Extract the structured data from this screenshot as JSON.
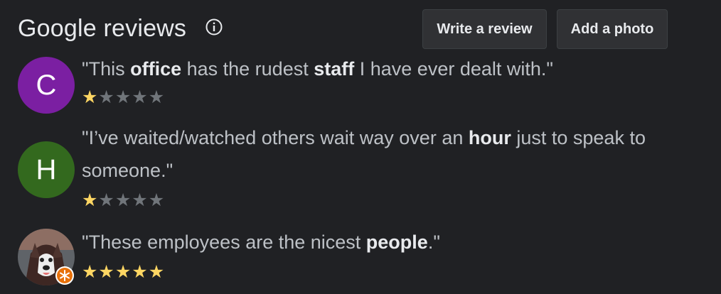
{
  "header": {
    "title": "Google reviews",
    "info_icon": "info-icon",
    "write_review_label": "Write a review",
    "add_photo_label": "Add a photo"
  },
  "colors": {
    "background": "#202124",
    "button_bg": "#303134",
    "star_filled": "#fdd663",
    "star_empty": "#70757a",
    "avatar_c": "#7b1fa2",
    "avatar_h": "#33691e"
  },
  "reviews": [
    {
      "avatar_letter": "C",
      "quote": [
        {
          "text": "\"This ",
          "bold": false
        },
        {
          "text": "office",
          "bold": true
        },
        {
          "text": " has the rudest ",
          "bold": false
        },
        {
          "text": "staff",
          "bold": true
        },
        {
          "text": " I have ever dealt with.\"",
          "bold": false
        }
      ],
      "rating": 1,
      "max_rating": 5
    },
    {
      "avatar_letter": "H",
      "quote": [
        {
          "text": "\"I’ve waited/watched others wait way over an ",
          "bold": false
        },
        {
          "text": "hour",
          "bold": true
        },
        {
          "text": " just to speak to someone.\"",
          "bold": false
        }
      ],
      "rating": 1,
      "max_rating": 5
    },
    {
      "avatar_letter": "",
      "avatar_image": "dog-photo-avatar",
      "badge_icon": "local-guide-badge-icon",
      "quote": [
        {
          "text": "\"These employees are the nicest ",
          "bold": false
        },
        {
          "text": "people",
          "bold": true
        },
        {
          "text": ".\"",
          "bold": false
        }
      ],
      "rating": 5,
      "max_rating": 5
    }
  ]
}
